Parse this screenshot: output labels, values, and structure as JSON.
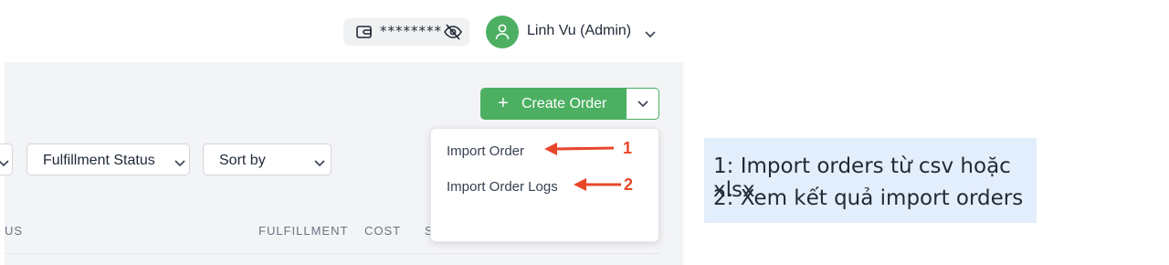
{
  "header": {
    "balance_mask": "********",
    "wallet_icon": "wallet-icon",
    "visibility_icon": "eye-off-icon",
    "user_name": "Linh Vu (Admin)",
    "avatar_icon": "user-icon",
    "accent_color": "#4caf61"
  },
  "toolbar": {
    "create_order_label": "Create Order",
    "create_order_icon": "plus-icon"
  },
  "filters": {
    "fulfillment_status": "Fulfillment Status",
    "sort_by": "Sort by"
  },
  "dropdown": {
    "items": [
      {
        "label": "Import Order"
      },
      {
        "label": "Import Order Logs"
      }
    ]
  },
  "table": {
    "columns": [
      "US",
      "FULFILLMENT",
      "COST",
      "S"
    ]
  },
  "annotations": {
    "markers": [
      "1",
      "2"
    ],
    "color": "#e8472b",
    "note_lines": [
      "1: Import orders từ csv hoặc xlsx",
      "2: Xem kết quả import orders"
    ]
  }
}
